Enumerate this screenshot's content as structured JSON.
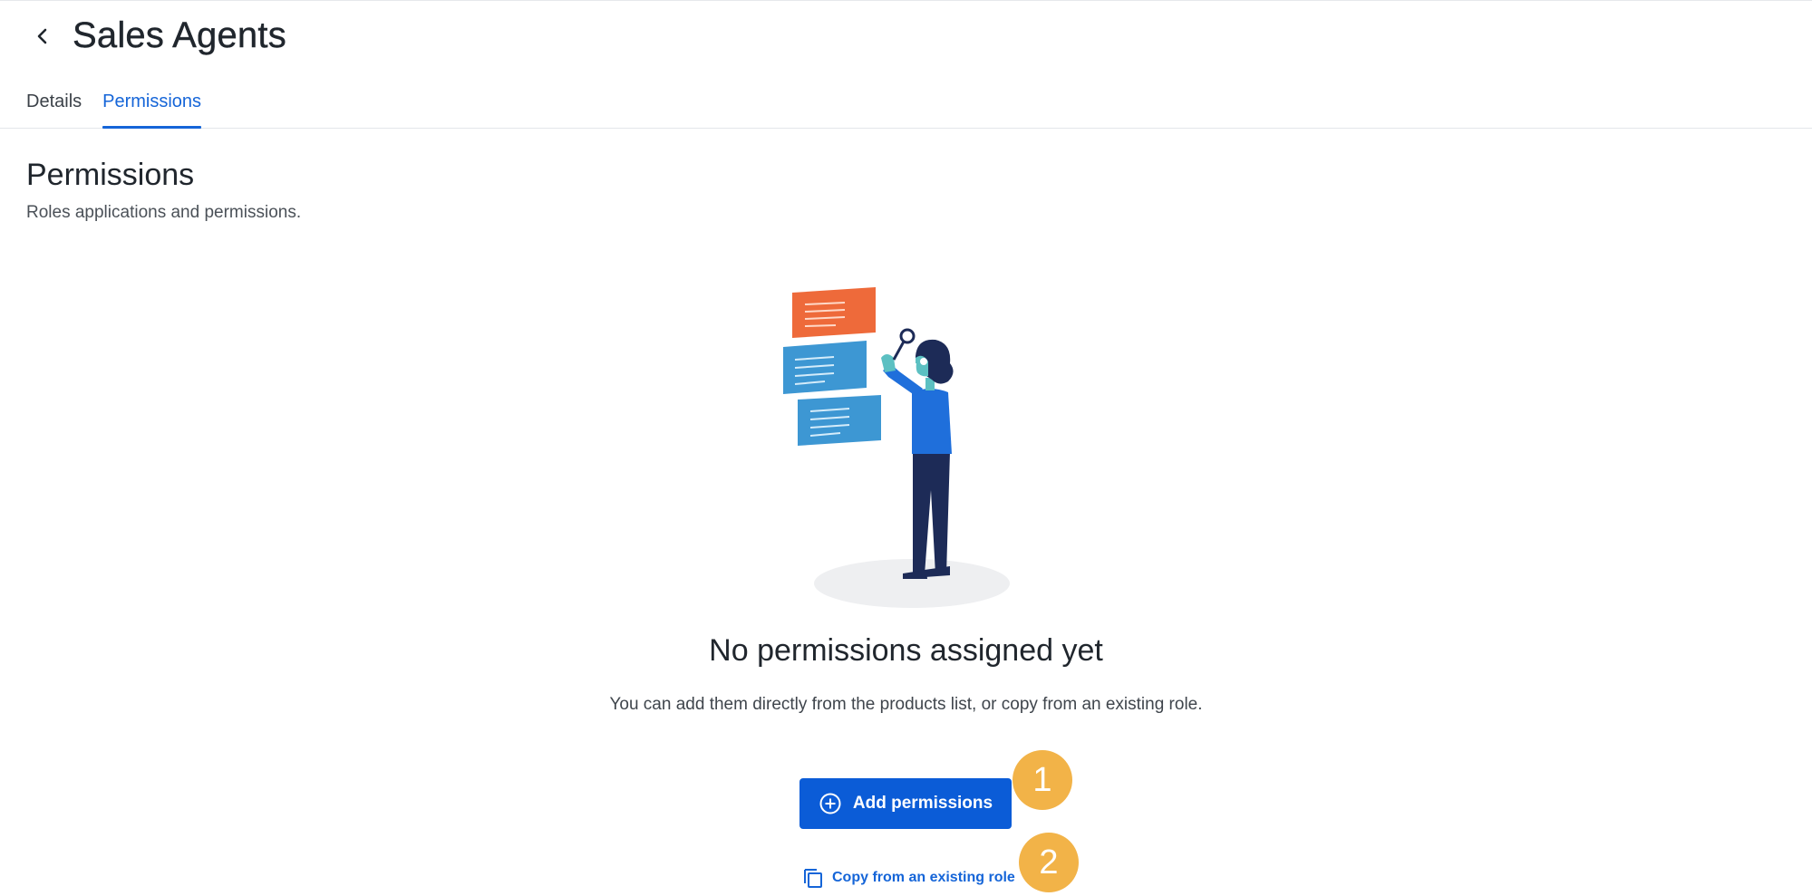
{
  "header": {
    "title": "Sales Agents",
    "back_icon": "chevron-left-icon"
  },
  "tabs": [
    {
      "label": "Details",
      "active": false
    },
    {
      "label": "Permissions",
      "active": true
    }
  ],
  "section": {
    "title": "Permissions",
    "subtitle": "Roles applications and permissions."
  },
  "empty_state": {
    "illustration": "person-with-magnifier-illustration",
    "title": "No permissions assigned yet",
    "description": "You can add them directly from the products list, or copy from an existing role."
  },
  "actions": {
    "add_label": "Add permissions",
    "add_icon": "plus-circle-icon",
    "copy_label": "Copy from an existing role",
    "copy_icon": "copy-icon"
  },
  "annotations": {
    "step1": "1",
    "step2": "2"
  },
  "colors": {
    "accent": "#0b5cd7",
    "link": "#1565d8",
    "badge": "#f2b348",
    "card_orange": "#ee6a3a",
    "card_blue": "#3d97d3",
    "figure_dark": "#1d2b57"
  }
}
